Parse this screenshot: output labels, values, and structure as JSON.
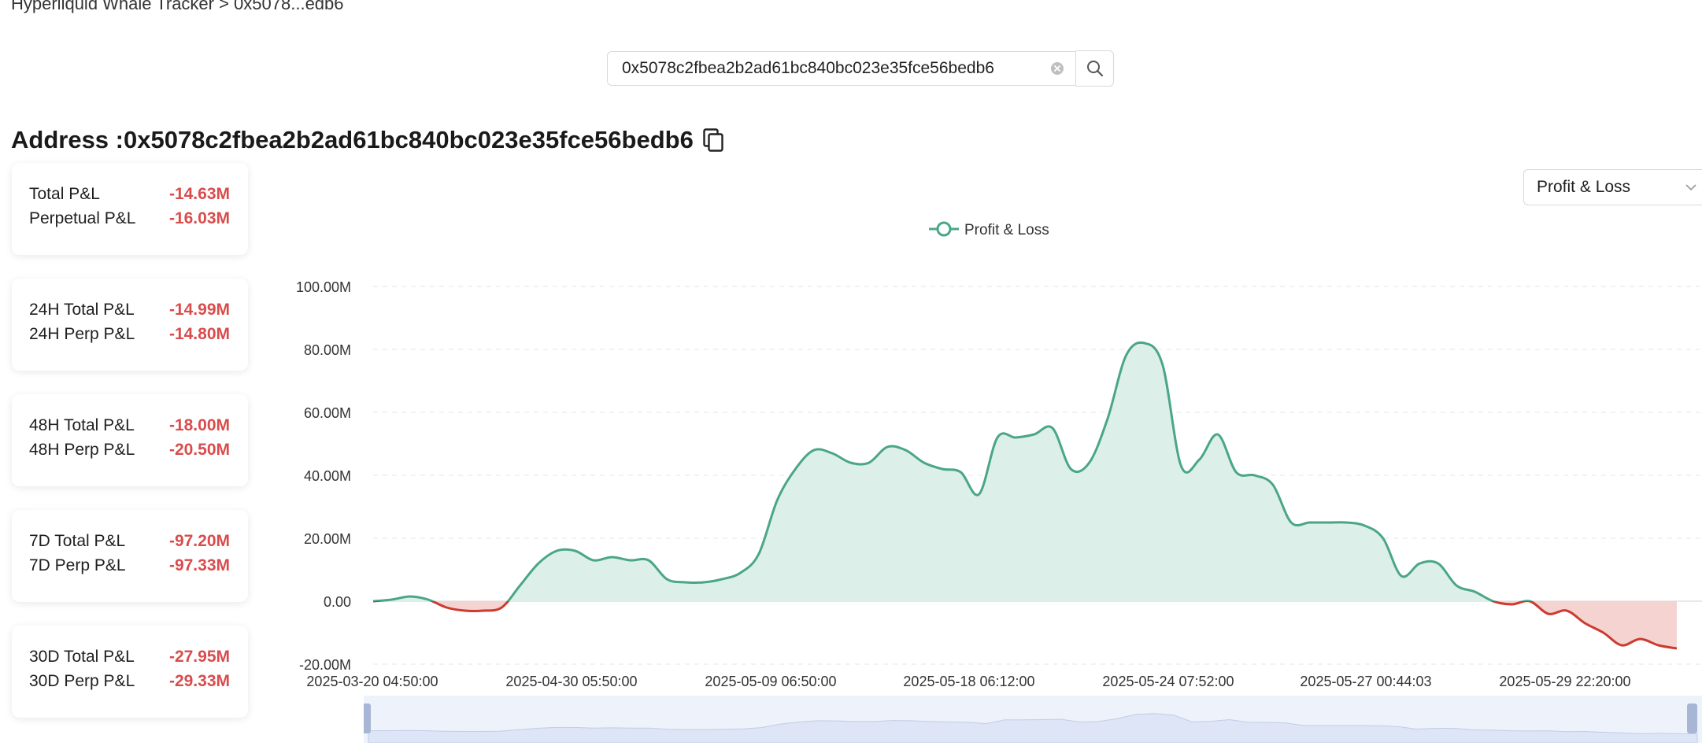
{
  "breadcrumb": "Hyperliquid Whale Tracker > 0x5078...edb6",
  "search": {
    "value": "0x5078c2fbea2b2ad61bc840bc023e35fce56bedb6"
  },
  "address": {
    "label": "Address :",
    "value": "0x5078c2fbea2b2ad61bc840bc023e35fce56bedb6"
  },
  "cards": [
    {
      "rows": [
        {
          "label": "Total P&L",
          "value": "-14.63M"
        },
        {
          "label": "Perpetual P&L",
          "value": "-16.03M"
        }
      ]
    },
    {
      "rows": [
        {
          "label": "24H Total P&L",
          "value": "-14.99M"
        },
        {
          "label": "24H Perp P&L",
          "value": "-14.80M"
        }
      ]
    },
    {
      "rows": [
        {
          "label": "48H Total P&L",
          "value": "-18.00M"
        },
        {
          "label": "48H Perp P&L",
          "value": "-20.50M"
        }
      ]
    },
    {
      "rows": [
        {
          "label": "7D Total P&L",
          "value": "-97.20M"
        },
        {
          "label": "7D Perp P&L",
          "value": "-97.33M"
        }
      ]
    },
    {
      "rows": [
        {
          "label": "30D Total P&L",
          "value": "-27.95M"
        },
        {
          "label": "30D Perp P&L",
          "value": "-29.33M"
        }
      ]
    }
  ],
  "metric_select": {
    "value": "Profit & Loss"
  },
  "chart_data": {
    "type": "area",
    "legend": [
      "Profit & Loss"
    ],
    "legend_position": "top-center",
    "ylim": [
      -20,
      100
    ],
    "ytick_values": [
      -20,
      0,
      20,
      40,
      60,
      80,
      100
    ],
    "ytick_labels": [
      "-20.00M",
      "0.00",
      "20.00M",
      "40.00M",
      "60.00M",
      "80.00M",
      "100.00M"
    ],
    "xtick_labels": [
      "2025-03-20 04:50:00",
      "2025-04-30 05:50:00",
      "2025-05-09 06:50:00",
      "2025-05-18 06:12:00",
      "2025-05-24 07:52:00",
      "2025-05-27 00:44:03",
      "2025-05-29 22:20:00"
    ],
    "grid": true,
    "colors": {
      "line": "#4aa688",
      "positive_fill": "#dcefe8",
      "negative_line": "#cc3a30",
      "negative_fill": "#f5d3d1"
    },
    "series": [
      {
        "name": "Profit & Loss",
        "values": [
          0,
          0.5,
          1.5,
          0.5,
          -2,
          -3,
          -3,
          -2,
          5,
          12,
          16,
          16,
          13,
          14,
          13,
          13,
          7,
          6,
          6,
          7,
          9,
          15,
          32,
          42,
          48,
          47,
          44,
          44,
          49,
          48,
          44,
          42,
          41,
          34,
          52,
          52,
          53,
          55,
          42,
          44,
          58,
          78,
          82,
          75,
          43,
          45,
          53,
          41,
          40,
          37,
          25,
          25,
          25,
          25,
          24,
          20,
          8,
          12,
          12,
          5,
          3,
          0,
          -1,
          0,
          -4,
          -3,
          -7,
          -10,
          -14,
          -12,
          -14,
          -15
        ]
      }
    ]
  }
}
